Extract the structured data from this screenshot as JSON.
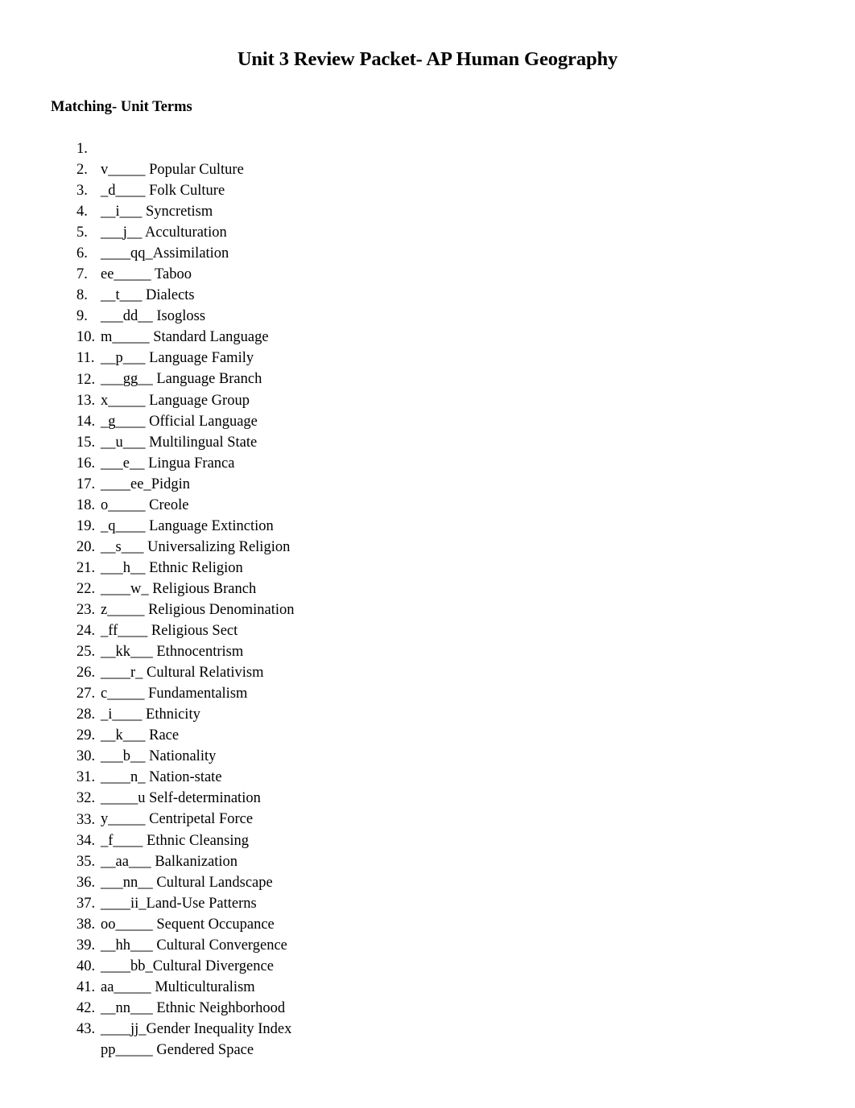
{
  "document": {
    "title": "Unit 3 Review Packet- AP Human Geography",
    "section_heading": "Matching- Unit Terms",
    "items": [
      {
        "number": "1.",
        "answer": "v_____",
        "term": "Popular Culture"
      },
      {
        "number": "2.",
        "answer": "_d____",
        "term": "Folk Culture"
      },
      {
        "number": "3.",
        "answer": "__i___",
        "term": "Syncretism"
      },
      {
        "number": "4.",
        "answer": "___j__",
        "term": "Acculturation"
      },
      {
        "number": "5.",
        "answer": "____qq_",
        "term": "Assimilation"
      },
      {
        "number": "6.",
        "answer": "ee_____",
        "term": "Taboo"
      },
      {
        "number": "7.",
        "answer": "__t___",
        "term": "Dialects"
      },
      {
        "number": "8.",
        "answer": "___dd__",
        "term": "Isogloss"
      },
      {
        "number": "9.",
        "answer": "m_____",
        "term": "Standard Language"
      },
      {
        "number": "10.",
        "answer": "__p___",
        "term": "Language Family"
      },
      {
        "number": "11.",
        "answer": "___gg__",
        "term": "Language Branch"
      },
      {
        "number": "12.",
        "answer": "x_____",
        "term": "Language Group"
      },
      {
        "number": "13.",
        "answer": "_g____",
        "term": "Official Language"
      },
      {
        "number": "14.",
        "answer": "__u___",
        "term": "Multilingual State"
      },
      {
        "number": "15.",
        "answer": "___e__",
        "term": "Lingua Franca"
      },
      {
        "number": "16.",
        "answer": "____ee_",
        "term": "Pidgin"
      },
      {
        "number": "17.",
        "answer": "o_____",
        "term": "Creole"
      },
      {
        "number": "18.",
        "answer": "_q____",
        "term": "Language Extinction"
      },
      {
        "number": "19.",
        "answer": "__s___",
        "term": "Universalizing Religion"
      },
      {
        "number": "20.",
        "answer": "___h__",
        "term": "Ethnic Religion"
      },
      {
        "number": "21.",
        "answer": "____w_",
        "term": "Religious Branch"
      },
      {
        "number": "22.",
        "answer": "z_____",
        "term": "Religious Denomination"
      },
      {
        "number": "23.",
        "answer": "_ff____",
        "term": "Religious Sect"
      },
      {
        "number": "24.",
        "answer": "__kk___",
        "term": "Ethnocentrism"
      },
      {
        "number": "25.",
        "answer": "____r_",
        "term": "Cultural Relativism"
      },
      {
        "number": "26.",
        "answer": "c_____",
        "term": "Fundamentalism"
      },
      {
        "number": "27.",
        "answer": "_i____",
        "term": "Ethnicity"
      },
      {
        "number": "28.",
        "answer": "__k___",
        "term": "Race"
      },
      {
        "number": "29.",
        "answer": "___b__",
        "term": "Nationality"
      },
      {
        "number": "30.",
        "answer": "____n_",
        "term": "Nation-state"
      },
      {
        "number": "31.",
        "answer": "_____u",
        "term": "Self-determination"
      },
      {
        "number": "32.",
        "answer": "y_____",
        "term": "Centripetal Force"
      },
      {
        "number": "33.",
        "answer": "_f____",
        "term": "Ethnic Cleansing"
      },
      {
        "number": "34.",
        "answer": "__aa___",
        "term": "Balkanization"
      },
      {
        "number": "35.",
        "answer": "___nn__",
        "term": "Cultural Landscape"
      },
      {
        "number": "36.",
        "answer": "____ii_",
        "term": "Land-Use Patterns"
      },
      {
        "number": "37.",
        "answer": "oo_____",
        "term": "Sequent Occupance"
      },
      {
        "number": "38.",
        "answer": "__hh___",
        "term": "Cultural Convergence"
      },
      {
        "number": "39.",
        "answer": "____bb_",
        "term": "Cultural Divergence"
      },
      {
        "number": "40.",
        "answer": "aa_____",
        "term": "Multiculturalism"
      },
      {
        "number": "41.",
        "answer": "__nn___",
        "term": "Ethnic Neighborhood"
      },
      {
        "number": "42.",
        "answer": "____jj_",
        "term": "Gender Inequality Index"
      },
      {
        "number": "43.",
        "answer": "pp_____",
        "term": "Gendered Space"
      }
    ]
  }
}
